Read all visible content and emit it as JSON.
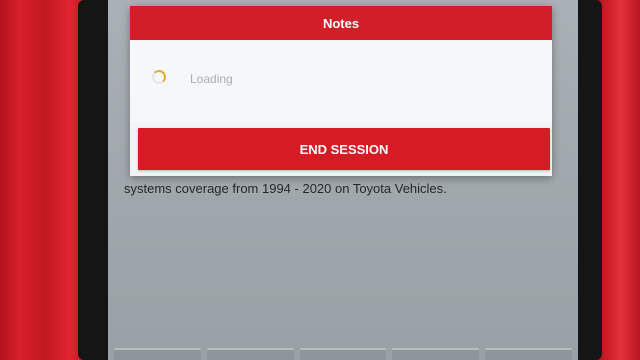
{
  "dialog": {
    "title": "Notes",
    "loading_text": "Loading",
    "end_session_label": "END SESSION"
  },
  "background": {
    "description_text": "systems coverage from 1994 - 2020 on Toyota Vehicles."
  },
  "colors": {
    "accent_red": "#d11f29",
    "screen_gray": "#a1a8ad",
    "spinner_accent": "#e3a93a"
  },
  "icons": {
    "loading": "loading-spinner-icon"
  }
}
